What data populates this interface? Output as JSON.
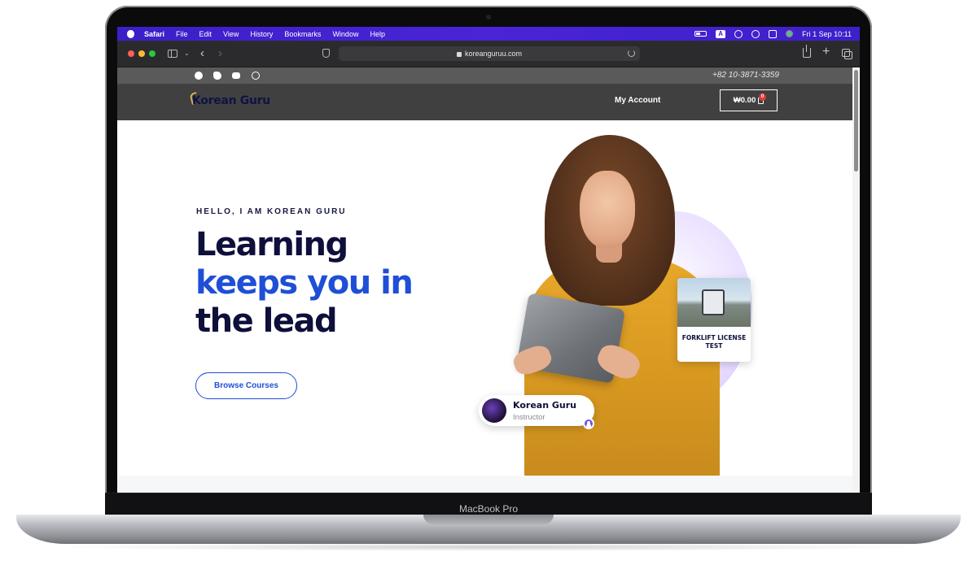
{
  "device": {
    "chin_label": "MacBook Pro"
  },
  "menubar": {
    "app": "Safari",
    "items": [
      "File",
      "Edit",
      "View",
      "History",
      "Bookmarks",
      "Window",
      "Help"
    ],
    "input_indicator": "A",
    "datetime": "Fri 1 Sep  10:11"
  },
  "browser": {
    "url": "koreanguruu.com"
  },
  "site": {
    "topbar": {
      "social_icons": [
        "facebook-icon",
        "twitter-icon",
        "youtube-icon",
        "whatsapp-icon"
      ],
      "phone": "+82 10-3871-3359"
    },
    "header": {
      "logo": "Korean Guru",
      "account_link": "My Account",
      "cart_total": "₩0.00",
      "cart_count": "0"
    },
    "hero": {
      "eyebrow": "HELLO, I AM KOREAN GURU",
      "headline_1": "Learning",
      "headline_2": "keeps you in",
      "headline_3": "the lead",
      "cta": "Browse Courses",
      "course_card_title": "FORKLIFT LICENSE TEST",
      "instructor_name": "Korean Guru",
      "instructor_role": "Instructor"
    }
  },
  "colors": {
    "menubar": "#3b1fc8",
    "brand_dark": "#0e0f3b",
    "accent_blue": "#1f4fd6",
    "header_bg": "#404040",
    "topbar_bg": "#5a5a5a",
    "sweater": "#e8a82a"
  }
}
